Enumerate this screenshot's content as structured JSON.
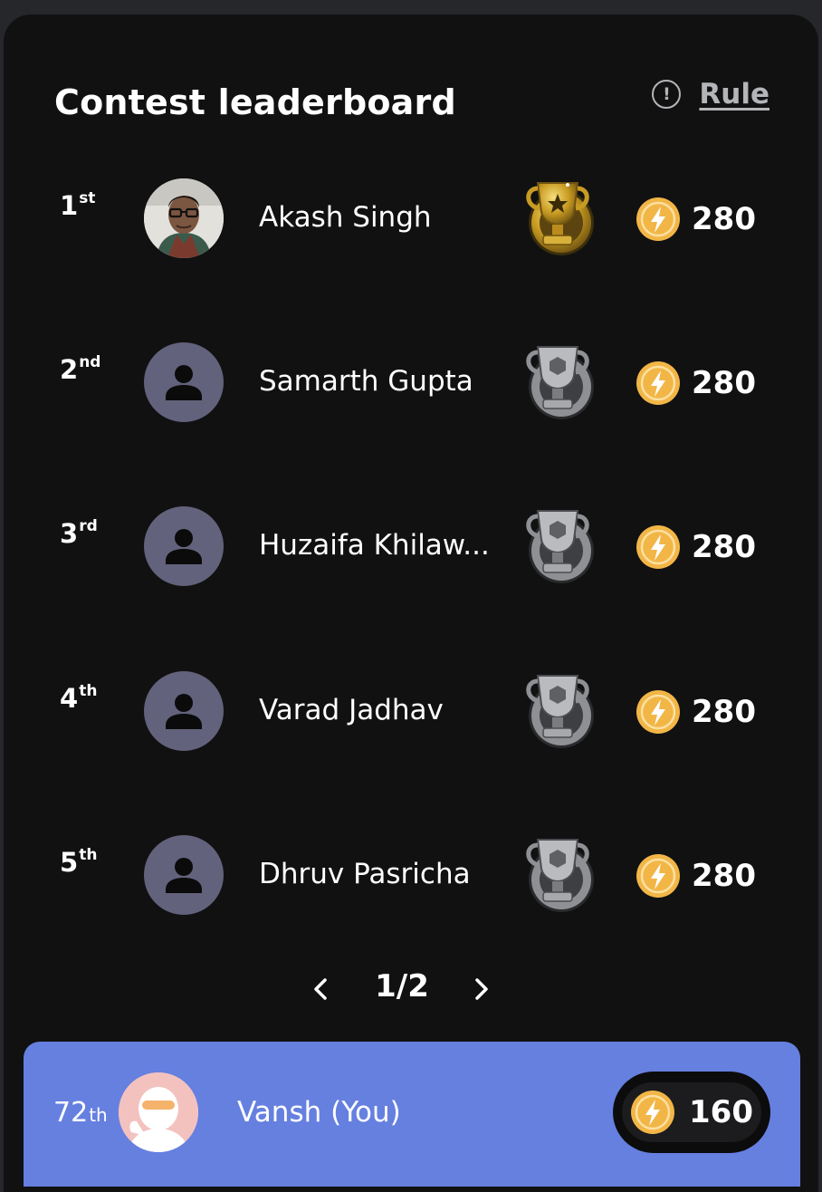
{
  "header": {
    "title": "Contest leaderboard",
    "rule_label": "Rule",
    "rule_icon": "exclamation-circle-icon"
  },
  "entries": [
    {
      "rank": "1",
      "suffix": "st",
      "name": "Akash Singh",
      "score": "280",
      "trophy": "gold-trophy-icon",
      "avatar": "photo"
    },
    {
      "rank": "2",
      "suffix": "nd",
      "name": "Samarth Gupta",
      "score": "280",
      "trophy": "silver-trophy-icon",
      "avatar": "default-user-icon"
    },
    {
      "rank": "3",
      "suffix": "rd",
      "name": "Huzaifa Khilaw...",
      "score": "280",
      "trophy": "silver-trophy-icon",
      "avatar": "default-user-icon"
    },
    {
      "rank": "4",
      "suffix": "th",
      "name": "Varad Jadhav",
      "score": "280",
      "trophy": "silver-trophy-icon",
      "avatar": "default-user-icon"
    },
    {
      "rank": "5",
      "suffix": "th",
      "name": "Dhruv Pasricha",
      "score": "280",
      "trophy": "silver-trophy-icon",
      "avatar": "default-user-icon"
    }
  ],
  "pagination": {
    "label": "1/2",
    "prev_icon": "chevron-left-icon",
    "next_icon": "chevron-right-icon"
  },
  "current_user": {
    "rank": "72",
    "suffix": "th",
    "name": "Vansh (You)",
    "score": "160",
    "avatar": "ninja-avatar"
  },
  "colors": {
    "card_bg": "#111112",
    "user_bar_bg": "#6680e0",
    "coin": "#f2b646",
    "avatar_placeholder": "#63627c",
    "gold": "#c9a227",
    "silver": "#8e9094"
  }
}
